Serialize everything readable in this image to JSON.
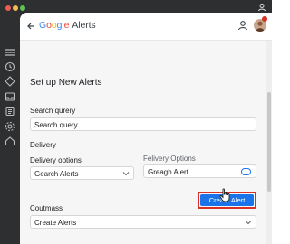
{
  "app": {
    "brand_google_g": "G",
    "brand_google_o1": "o",
    "brand_google_o2": "o",
    "brand_google_g2": "g",
    "brand_google_l": "l",
    "brand_google_e": "e",
    "brand_alerts": "Alerts"
  },
  "page": {
    "title": "Set up New Alerts"
  },
  "search": {
    "label": "Search qurery",
    "placeholder": "Search query"
  },
  "delivery": {
    "section_label": "Delivery",
    "options_label": "Delivery options",
    "options_value": "Gearch Alerts",
    "felivery_label": "Felivery Options",
    "felivery_value": "Greagh Alert"
  },
  "create_button": {
    "label": "Create Alert"
  },
  "coutmass": {
    "label": "Coutmass",
    "value": "Create Alerts"
  },
  "icons": [
    "back-arrow-icon",
    "user-icon",
    "avatar",
    "chevron-down-icon",
    "toggle-icon",
    "cursor-icon"
  ],
  "colors": {
    "accent": "#1a73e8",
    "highlight": "#d93025"
  }
}
